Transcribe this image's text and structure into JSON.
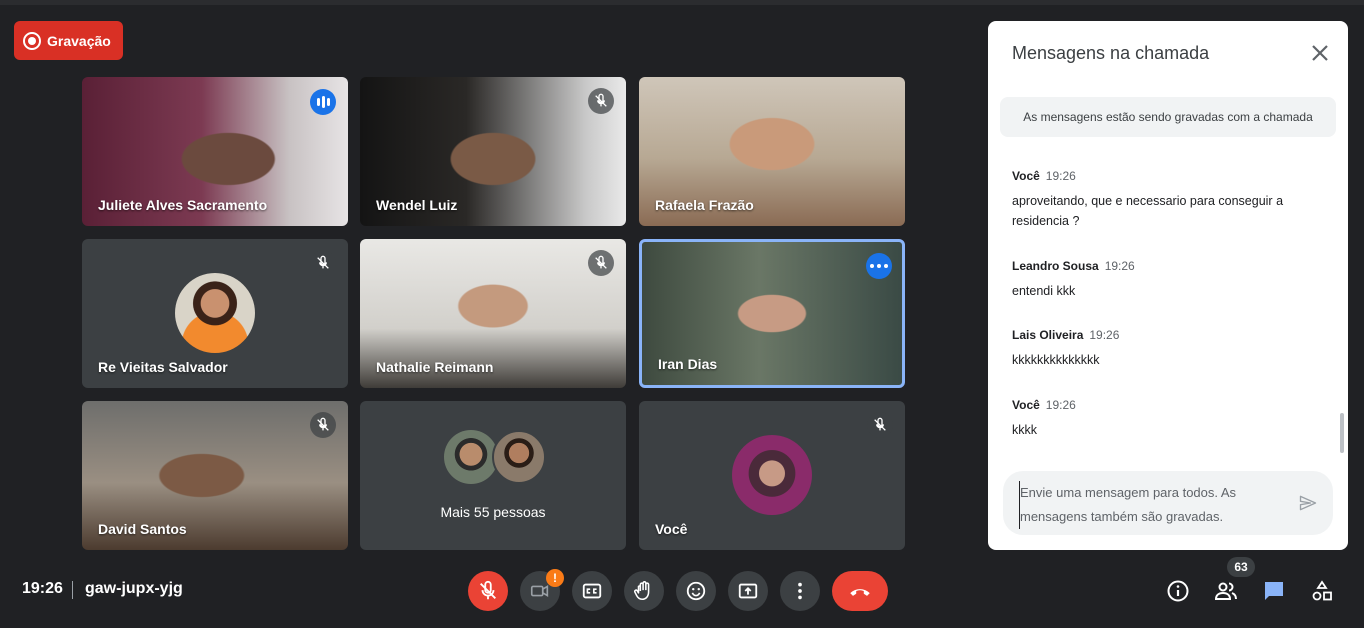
{
  "recording": {
    "label": "Gravação"
  },
  "tiles": [
    {
      "name": "Juliete Alves Sacramento",
      "status": "speaking"
    },
    {
      "name": "Wendel Luiz",
      "status": "muted"
    },
    {
      "name": "Rafaela Frazão",
      "status": "none"
    },
    {
      "name": "Re Vieitas Salvador",
      "status": "muted"
    },
    {
      "name": "Nathalie Reimann",
      "status": "muted"
    },
    {
      "name": "Iran Dias",
      "status": "active"
    },
    {
      "name": "David Santos",
      "status": "muted"
    },
    {
      "name": "Mais 55 pessoas",
      "status": "none"
    },
    {
      "name": "Você",
      "status": "muted"
    }
  ],
  "chat": {
    "title": "Mensagens na chamada",
    "notice": "As mensagens estão sendo gravadas com a chamada",
    "messages": [
      {
        "author": "Você",
        "time": "19:26",
        "text": "aproveitando, que e necessario para conseguir a residencia ?"
      },
      {
        "author": "Leandro Sousa",
        "time": "19:26",
        "text": "entendi kkk"
      },
      {
        "author": "Lais Oliveira",
        "time": "19:26",
        "text": "kkkkkkkkkkkkkk"
      },
      {
        "author": "Você",
        "time": "19:26",
        "text": "kkkk"
      }
    ],
    "composer_placeholder": "Envie uma mensagem para todos. As mensagens também são gravadas."
  },
  "bottom": {
    "clock": "19:26",
    "meeting_code": "gaw-jupx-yjg",
    "camera_warning": "!",
    "participants_count": "63"
  },
  "colors": {
    "accent": "#1a73e8",
    "danger": "#ea4335",
    "background": "#202124",
    "tile": "#3c4043",
    "warning": "#fa7b17"
  }
}
